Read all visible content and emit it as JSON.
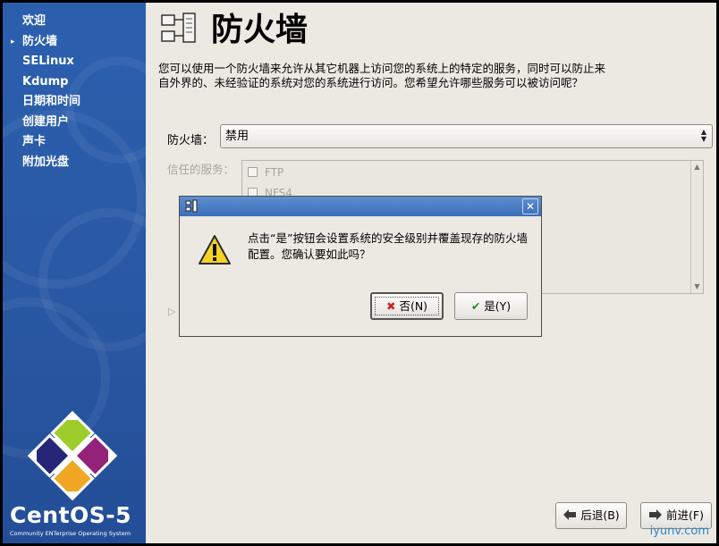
{
  "sidebar": {
    "current_index": 1,
    "steps": [
      "欢迎",
      "防火墙",
      "SELinux",
      "Kdump",
      "日期和时间",
      "创建用户",
      "声卡",
      "附加光盘"
    ],
    "logo_text": "CentOS-5",
    "logo_subtext": "Community ENTerprise Operating System"
  },
  "page": {
    "title": "防火墙",
    "description": "您可以使用一个防火墙来允许从其它机器上访问您的系统上的特定的服务，同时可以防止来自外界的、未经验证的系统对您的系统进行访问。您希望允许哪些服务可以被访问呢？",
    "firewall_label": "防火墙：",
    "firewall_value": "禁用",
    "trusted_label": "信任的服务：",
    "services": [
      "FTP",
      "NFS4"
    ]
  },
  "dialog": {
    "message": "点击“是”按钮会设置系统的安全级别并覆盖现存的防火墙配置。您确认要如此吗？",
    "no_label": "否(N)",
    "yes_label": "是(Y)",
    "close_glyph": "✕"
  },
  "footer": {
    "back_label": "后退(B)",
    "forward_label": "前进(F)"
  },
  "watermark": "iyunv.com",
  "colors": {
    "sidebar": "#2a5aa6",
    "titlebar": "#4a7dc4",
    "background": "#ece9e3"
  }
}
